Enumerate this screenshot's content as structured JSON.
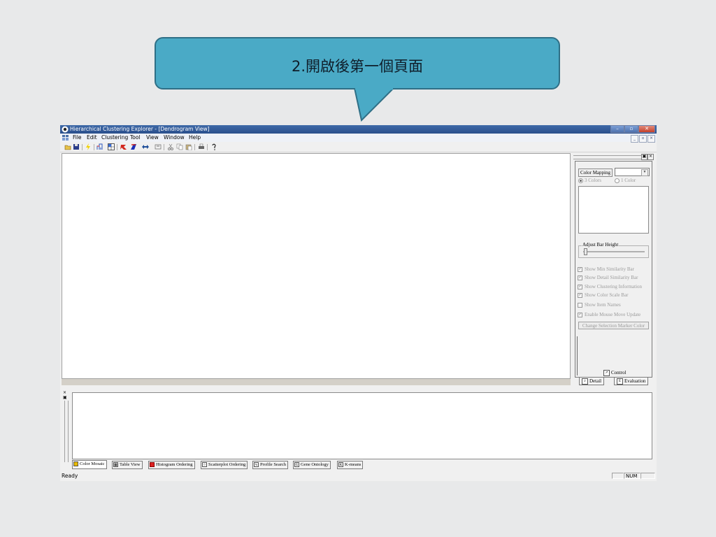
{
  "callout": {
    "text": "2.開啟後第一個頁面",
    "fill_color": "#4aaac6",
    "border_color": "#2f6f86"
  },
  "window": {
    "title": "Hierarchical Clustering Explorer - [Dendrogram View]",
    "title_icon": "eye-icon",
    "controls": [
      "minimize",
      "maximize",
      "close"
    ]
  },
  "menubar": {
    "items": [
      "File",
      "Edit",
      "Clustering",
      "Tool",
      "View",
      "Window",
      "Help"
    ],
    "mdi_controls": [
      "_",
      "▫",
      "×"
    ]
  },
  "toolbar": {
    "icons": [
      "open-folder-icon",
      "save-icon",
      "lightning-icon",
      "dendrogram-icon",
      "grid-icon",
      "red-arrow-icon",
      "blue-arrow-icon",
      "swap-icon",
      "filter-icon",
      "cut-icon",
      "copy-icon",
      "paste-icon",
      "print-icon",
      "help-icon"
    ]
  },
  "control_panel": {
    "header_buttons": [
      "▣",
      "×"
    ],
    "color_mapping_label": "Color Mapping",
    "radio_3": "3 Colors",
    "radio_1": "1 Color",
    "radio_selected": "3 Colors",
    "adjust_bar_height_label": "Adjust Bar Height",
    "checkboxes": [
      {
        "label": "Show Min Similarity Bar",
        "checked": true
      },
      {
        "label": "Show Detail Similarity Bar",
        "checked": true
      },
      {
        "label": "Show Clustering Information",
        "checked": true
      },
      {
        "label": "Show Color Scale Bar",
        "checked": true
      },
      {
        "label": "Show Item Names",
        "checked": false
      },
      {
        "label": "Enable Mouse Move Update",
        "checked": true
      }
    ],
    "change_marker_button": "Change Selection Marker Color",
    "control_label": "Control",
    "tabs": [
      "Detail",
      "Evaluation"
    ]
  },
  "bottom_tabs": [
    {
      "label": "Color Mosaic",
      "icon": "color-mosaic-icon"
    },
    {
      "label": "Table View",
      "icon": "table-icon"
    },
    {
      "label": "Histogram Ordering",
      "icon": "histogram-icon"
    },
    {
      "label": "Scatterplot Ordering",
      "icon": "scatterplot-icon"
    },
    {
      "label": "Profile Search",
      "icon": "profile-icon"
    },
    {
      "label": "Gene Ontology",
      "icon": "g-icon"
    },
    {
      "label": "K-means",
      "icon": "k-icon"
    }
  ],
  "bottom_tabs_active": "Color Mosaic",
  "statusbar": {
    "status": "Ready",
    "num_indicator": "NUM"
  }
}
